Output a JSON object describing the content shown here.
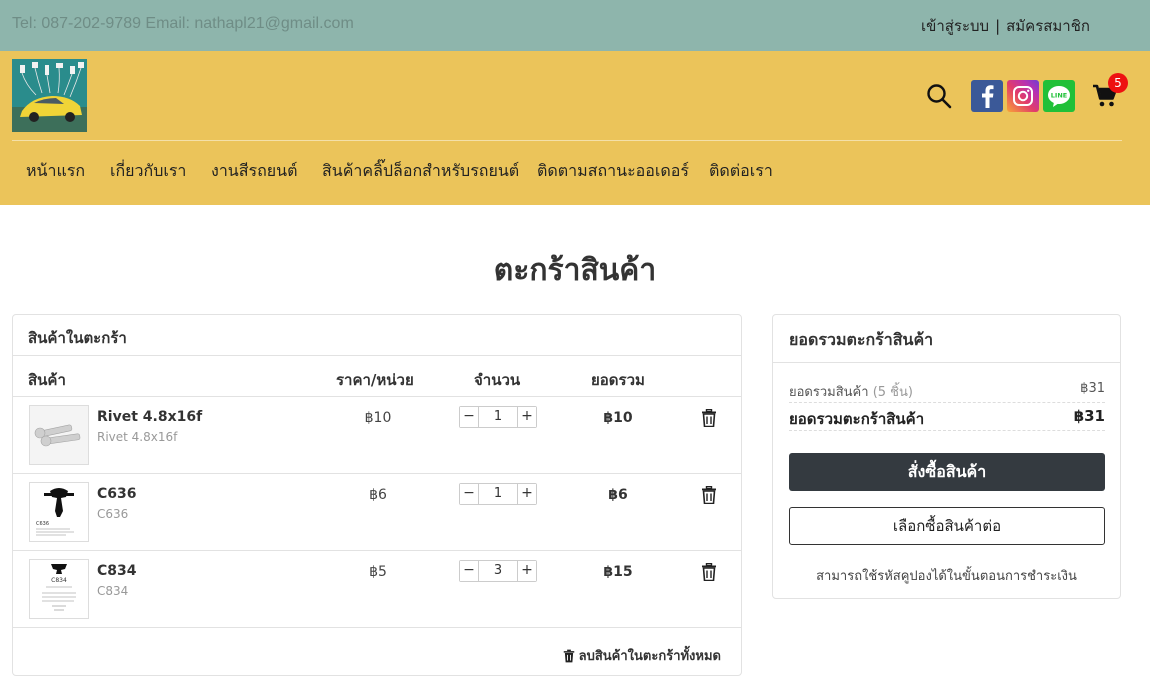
{
  "topbar": {
    "contact": "Tel: 087-202-9789 Email: nathapl21@gmail.com",
    "login": "เข้าสู่ระบบ",
    "separator": "|",
    "register": "สมัครสมาชิก"
  },
  "header": {
    "cart_count": "5",
    "icons": [
      "search-icon",
      "facebook-icon",
      "instagram-icon",
      "line-icon",
      "cart-icon"
    ]
  },
  "nav": {
    "items": [
      "หน้าแรก",
      "เกี่ยวกับเรา",
      "งานสีรถยนต์",
      "สินค้าคลิ๊ปล็อกสำหรับรถยนต์",
      "ติดตามสถานะออเดอร์",
      "ติดต่อเรา"
    ]
  },
  "page": {
    "title": "ตะกร้าสินค้า"
  },
  "cart": {
    "heading": "สินค้าในตะกร้า",
    "columns": {
      "product": "สินค้า",
      "unit_price": "ราคา/หน่วย",
      "quantity": "จำนวน",
      "total": "ยอดรวม"
    },
    "items": [
      {
        "name": "Rivet 4.8x16f",
        "sku": "Rivet 4.8x16f",
        "price": "฿10",
        "qty": "1",
        "total": "฿10",
        "thumb_label": ""
      },
      {
        "name": "C636",
        "sku": "C636",
        "price": "฿6",
        "qty": "1",
        "total": "฿6",
        "thumb_label": "C636"
      },
      {
        "name": "C834",
        "sku": "C834",
        "price": "฿5",
        "qty": "3",
        "total": "฿15",
        "thumb_label": "C834"
      }
    ],
    "qty_minus": "−",
    "qty_plus": "+",
    "clear_all": "ลบสินค้าในตะกร้าทั้งหมด"
  },
  "summary": {
    "heading": "ยอดรวมตะกร้าสินค้า",
    "subtotal_label": "ยอดรวมสินค้า",
    "subtotal_count": "(5 ชิ้น)",
    "subtotal_value": "฿31",
    "grand_label": "ยอดรวมตะกร้าสินค้า",
    "grand_value": "฿31",
    "checkout": "สั่งซื้อสินค้า",
    "continue": "เลือกซื้อสินค้าต่อ",
    "coupon_note": "สามารถใช้รหัสคูปองได้ในขั้นตอนการชำระเงิน"
  }
}
